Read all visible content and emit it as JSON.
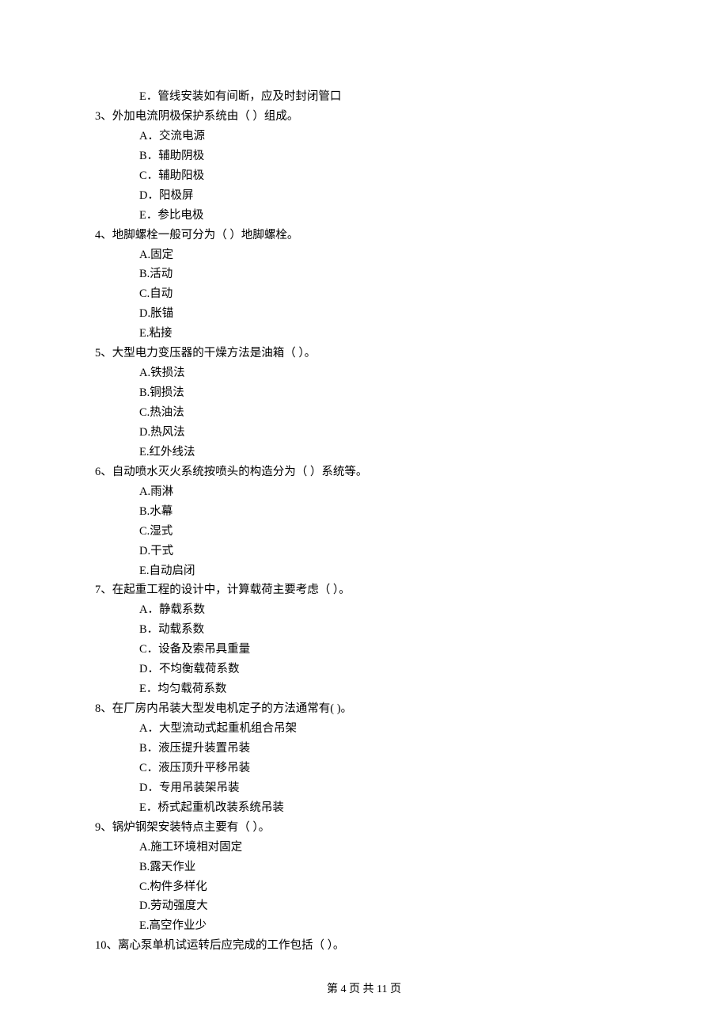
{
  "q2_trailing_option_E": "E．管线安装如有间断，应及时封闭管口",
  "questions": [
    {
      "num": "3、",
      "stem": "外加电流阴极保护系统由（    ）组成。",
      "options": [
        "A．交流电源",
        "B．辅助阴极",
        "C．辅助阳极",
        "D．阳极屏",
        "E．参比电极"
      ]
    },
    {
      "num": "4、",
      "stem": "地脚螺栓一般可分为（   ）地脚螺栓。",
      "options": [
        "A.固定",
        "B.活动",
        "C.自动",
        "D.胀锚",
        "E.粘接"
      ]
    },
    {
      "num": "5、",
      "stem": "大型电力变压器的干燥方法是油箱（   ）。",
      "options": [
        "A.铁损法",
        "B.铜损法",
        "C.热油法",
        "D.热风法",
        "E.红外线法"
      ]
    },
    {
      "num": "6、",
      "stem": "自动喷水灭火系统按喷头的构造分为（    ）系统等。",
      "options": [
        "A.雨淋",
        "B.水幕",
        "C.湿式",
        "D.干式",
        "E.自动启闭"
      ]
    },
    {
      "num": "7、",
      "stem": "在起重工程的设计中，计算载荷主要考虑（    ）。",
      "options": [
        "A．静载系数",
        "B．动载系数",
        "C．设备及索吊具重量",
        "D．不均衡载荷系数",
        "E．均匀载荷系数"
      ]
    },
    {
      "num": "8、",
      "stem": "在厂房内吊装大型发电机定子的方法通常有(    )。",
      "options": [
        "A．大型流动式起重机组合吊架",
        "B．液压提升装置吊装",
        "C．液压顶升平移吊装",
        "D．专用吊装架吊装",
        "E．桥式起重机改装系统吊装"
      ]
    },
    {
      "num": "9、",
      "stem": "锅炉钢架安装特点主要有（    ）。",
      "options": [
        "A.施工环境相对固定",
        "B.露天作业",
        "C.构件多样化",
        "D.劳动强度大",
        "E.高空作业少"
      ]
    },
    {
      "num": "10、",
      "stem": "离心泵单机试运转后应完成的工作包括（    ）。",
      "options": []
    }
  ],
  "footer": "第 4 页 共 11 页"
}
